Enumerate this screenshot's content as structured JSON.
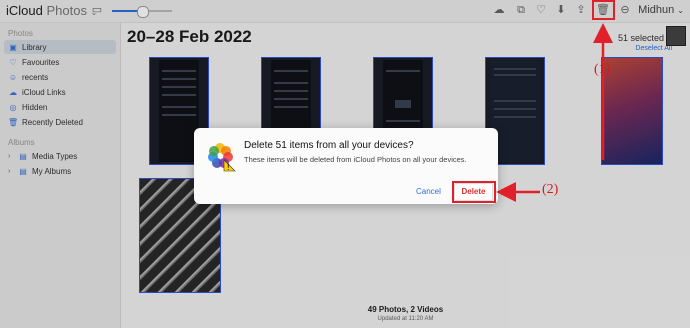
{
  "toolbar": {
    "app_title": "iCloud",
    "app_subtitle": "Photos",
    "user_menu": "Midhun",
    "zoom_level": 0.5
  },
  "sidebar": {
    "section_photos": "Photos",
    "items": [
      {
        "label": "Library",
        "icon": "library-icon",
        "selected": true
      },
      {
        "label": "Favourites",
        "icon": "heart-icon"
      },
      {
        "label": "recents",
        "icon": "user-icon"
      },
      {
        "label": "iCloud Links",
        "icon": "cloud-link-icon"
      },
      {
        "label": "Hidden",
        "icon": "eye-slash-icon"
      },
      {
        "label": "Recently Deleted",
        "icon": "trash-icon"
      }
    ],
    "section_albums": "Albums",
    "album_items": [
      {
        "label": "Media Types",
        "icon": "folder-icon"
      },
      {
        "label": "My Albums",
        "icon": "folder-icon"
      }
    ]
  },
  "main": {
    "date_title": "20–28 Feb 2022",
    "selected_count": "51 selected",
    "deselect_all": "Deselect All",
    "footer_count": "49 Photos, 2 Videos",
    "footer_updated": "Updated at 11:20 AM"
  },
  "dialog": {
    "title": "Delete 51 items from all your devices?",
    "message": "These items will be deleted from iCloud Photos on all your devices.",
    "cancel_label": "Cancel",
    "delete_label": "Delete"
  },
  "annotations": {
    "label_1": "(1)",
    "label_2": "(2)",
    "color": "#e0202a"
  },
  "colors": {
    "selection_border": "#2f55e0",
    "accent_blue": "#2a6fdb",
    "delete_red": "#e03030"
  }
}
